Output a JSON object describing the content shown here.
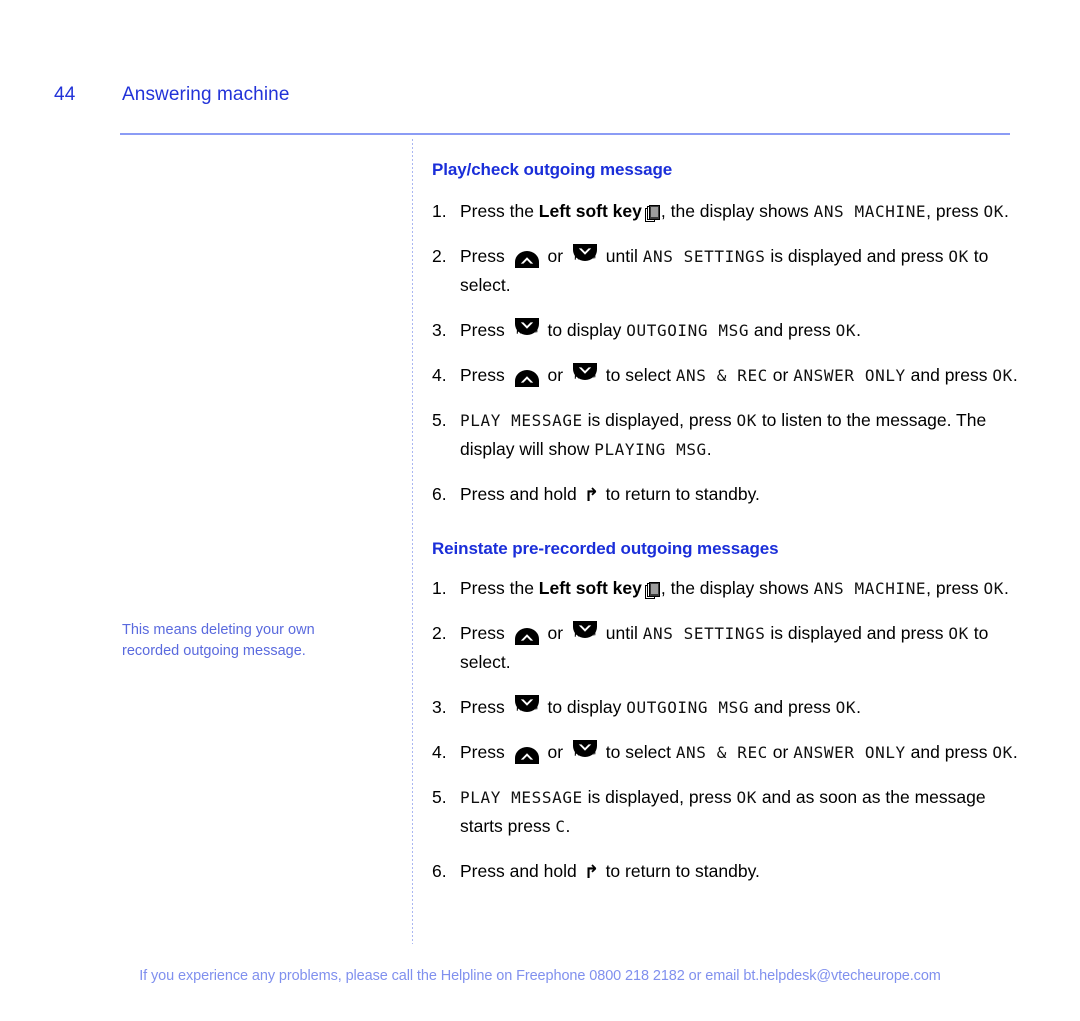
{
  "header": {
    "page_number": "44",
    "title": "Answering machine"
  },
  "margin_note": {
    "text": "This means deleting your own recorded outgoing message."
  },
  "icons": {
    "soft_key": "soft-key-icon",
    "calls_key_label": "Calls",
    "redial_key_label": "Redial",
    "return_arrow": "↰"
  },
  "sections": [
    {
      "heading": "Play/check outgoing message",
      "steps": [
        {
          "number": "1.",
          "parts": [
            {
              "type": "text",
              "value": "Press the "
            },
            {
              "type": "bold",
              "value": "Left soft key"
            },
            {
              "type": "icon",
              "value": "soft-key-icon"
            },
            {
              "type": "text",
              "value": ", the display shows "
            },
            {
              "type": "lcd",
              "value": "ANS MACHINE"
            },
            {
              "type": "text",
              "value": ", press "
            },
            {
              "type": "lcd",
              "value": "OK"
            },
            {
              "type": "text",
              "value": "."
            }
          ]
        },
        {
          "number": "2.",
          "parts": [
            {
              "type": "text",
              "value": "Press "
            },
            {
              "type": "icon",
              "value": "calls-key-icon"
            },
            {
              "type": "text",
              "value": " or "
            },
            {
              "type": "icon",
              "value": "redial-key-icon"
            },
            {
              "type": "text",
              "value": " until "
            },
            {
              "type": "lcd",
              "value": "ANS SETTINGS"
            },
            {
              "type": "text",
              "value": " is displayed and press "
            },
            {
              "type": "lcd",
              "value": "OK"
            },
            {
              "type": "text",
              "value": " to select."
            }
          ]
        },
        {
          "number": "3.",
          "parts": [
            {
              "type": "text",
              "value": "Press "
            },
            {
              "type": "icon",
              "value": "redial-key-icon"
            },
            {
              "type": "text",
              "value": " to display "
            },
            {
              "type": "lcd",
              "value": "OUTGOING MSG"
            },
            {
              "type": "text",
              "value": " and press "
            },
            {
              "type": "lcd",
              "value": "OK"
            },
            {
              "type": "text",
              "value": "."
            }
          ]
        },
        {
          "number": "4.",
          "parts": [
            {
              "type": "text",
              "value": "Press "
            },
            {
              "type": "icon",
              "value": "calls-key-icon"
            },
            {
              "type": "text",
              "value": " or "
            },
            {
              "type": "icon",
              "value": "redial-key-icon"
            },
            {
              "type": "text",
              "value": " to select "
            },
            {
              "type": "lcd",
              "value": "ANS & REC"
            },
            {
              "type": "text",
              "value": " or "
            },
            {
              "type": "lcd",
              "value": "ANSWER ONLY"
            },
            {
              "type": "text",
              "value": " and press "
            },
            {
              "type": "lcd",
              "value": "OK"
            },
            {
              "type": "text",
              "value": "."
            }
          ]
        },
        {
          "number": "5.",
          "parts": [
            {
              "type": "lcd",
              "value": "PLAY MESSAGE"
            },
            {
              "type": "text",
              "value": " is displayed, press "
            },
            {
              "type": "lcd",
              "value": "OK"
            },
            {
              "type": "text",
              "value": " to listen to the message. The display will show "
            },
            {
              "type": "lcd",
              "value": "PLAYING MSG"
            },
            {
              "type": "text",
              "value": "."
            }
          ]
        },
        {
          "number": "6.",
          "parts": [
            {
              "type": "text",
              "value": "Press and hold "
            },
            {
              "type": "icon",
              "value": "return-arrow-icon"
            },
            {
              "type": "text",
              "value": " to return to standby."
            }
          ]
        }
      ]
    },
    {
      "heading": "Reinstate pre-recorded outgoing messages",
      "steps": [
        {
          "number": "1.",
          "parts": [
            {
              "type": "text",
              "value": "Press the "
            },
            {
              "type": "bold",
              "value": "Left soft key"
            },
            {
              "type": "icon",
              "value": "soft-key-icon"
            },
            {
              "type": "text",
              "value": ", the display shows "
            },
            {
              "type": "lcd",
              "value": "ANS MACHINE"
            },
            {
              "type": "text",
              "value": ", press "
            },
            {
              "type": "lcd",
              "value": "OK"
            },
            {
              "type": "text",
              "value": "."
            }
          ]
        },
        {
          "number": "2.",
          "parts": [
            {
              "type": "text",
              "value": "Press "
            },
            {
              "type": "icon",
              "value": "calls-key-icon"
            },
            {
              "type": "text",
              "value": " or "
            },
            {
              "type": "icon",
              "value": "redial-key-icon"
            },
            {
              "type": "text",
              "value": " until "
            },
            {
              "type": "lcd",
              "value": "ANS SETTINGS"
            },
            {
              "type": "text",
              "value": " is displayed and press "
            },
            {
              "type": "lcd",
              "value": "OK"
            },
            {
              "type": "text",
              "value": " to select."
            }
          ]
        },
        {
          "number": "3.",
          "parts": [
            {
              "type": "text",
              "value": "Press "
            },
            {
              "type": "icon",
              "value": "redial-key-icon"
            },
            {
              "type": "text",
              "value": " to display "
            },
            {
              "type": "lcd",
              "value": "OUTGOING MSG"
            },
            {
              "type": "text",
              "value": " and press "
            },
            {
              "type": "lcd",
              "value": "OK"
            },
            {
              "type": "text",
              "value": "."
            }
          ]
        },
        {
          "number": "4.",
          "parts": [
            {
              "type": "text",
              "value": "Press "
            },
            {
              "type": "icon",
              "value": "calls-key-icon"
            },
            {
              "type": "text",
              "value": " or "
            },
            {
              "type": "icon",
              "value": "redial-key-icon"
            },
            {
              "type": "text",
              "value": " to select "
            },
            {
              "type": "lcd",
              "value": "ANS & REC"
            },
            {
              "type": "text",
              "value": " or "
            },
            {
              "type": "lcd",
              "value": "ANSWER ONLY"
            },
            {
              "type": "text",
              "value": " and press "
            },
            {
              "type": "lcd",
              "value": "OK"
            },
            {
              "type": "text",
              "value": "."
            }
          ]
        },
        {
          "number": "5.",
          "parts": [
            {
              "type": "lcd",
              "value": "PLAY MESSAGE"
            },
            {
              "type": "text",
              "value": " is displayed, press "
            },
            {
              "type": "lcd",
              "value": "OK"
            },
            {
              "type": "text",
              "value": " and as soon as the message starts press "
            },
            {
              "type": "lcd",
              "value": "C"
            },
            {
              "type": "text",
              "value": "."
            }
          ]
        },
        {
          "number": "6.",
          "parts": [
            {
              "type": "text",
              "value": "Press and hold "
            },
            {
              "type": "icon",
              "value": "return-arrow-icon"
            },
            {
              "type": "text",
              "value": " to return to standby."
            }
          ]
        }
      ]
    }
  ],
  "footer": {
    "text": "If you experience any problems, please call the Helpline on Freephone 0800 218 2182 or email bt.helpdesk@vtecheurope.com"
  },
  "colors": {
    "heading_blue": "#1a2ed9",
    "header_blue": "#2233d8",
    "note_blue": "#5a6ade",
    "footer_blue": "#8090ee",
    "rule_blue": "#8b9cf5",
    "divider_blue": "#aab7f2"
  }
}
